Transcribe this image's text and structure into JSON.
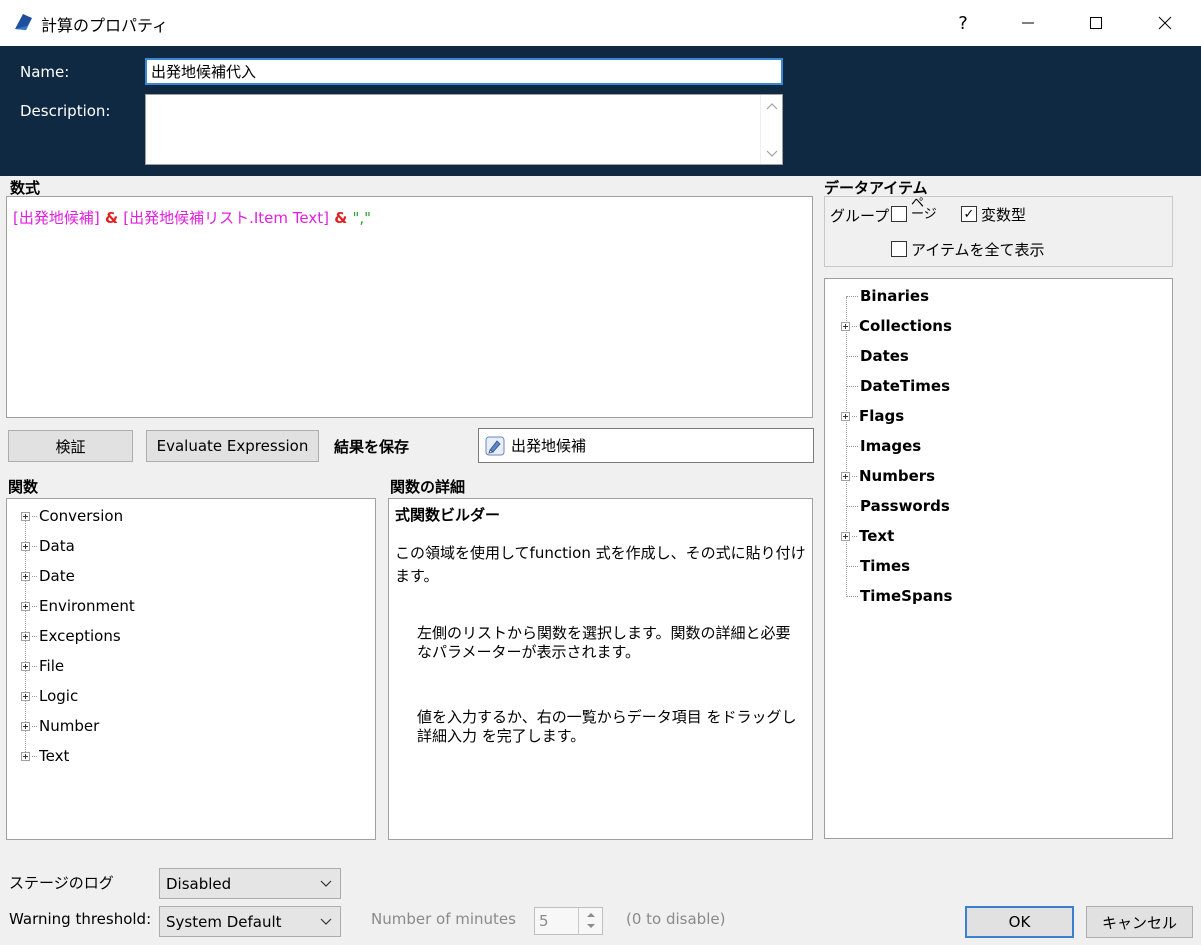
{
  "window": {
    "title": "計算のプロパティ",
    "help": "?",
    "app_icon": "blueprism-icon"
  },
  "header": {
    "name_label": "Name:",
    "name_value": "出発地候補代入",
    "description_label": "Description:",
    "description_value": ""
  },
  "formula": {
    "label": "数式",
    "tokens": [
      {
        "text": "[出発地候補]",
        "color": "#e020e0"
      },
      {
        "text": " & ",
        "color": "#e02020"
      },
      {
        "text": "[出発地候補リスト.Item Text]",
        "color": "#e020e0"
      },
      {
        "text": " & ",
        "color": "#e02020"
      },
      {
        "text": "\",\"",
        "color": "#30a030"
      }
    ]
  },
  "toolbar": {
    "verify_label": "検証",
    "evaluate_label": "Evaluate Expression",
    "save_result_label": "結果を保存",
    "save_result_value": "出発地候補"
  },
  "functions": {
    "label": "関数",
    "items": [
      "Conversion",
      "Data",
      "Date",
      "Environment",
      "Exceptions",
      "File",
      "Logic",
      "Number",
      "Text"
    ]
  },
  "details": {
    "label": "関数の詳細",
    "title": "式関数ビルダー",
    "intro": "この領域を使用してfunction 式を作成し、その式に貼り付けます。",
    "p1": "左側のリストから関数を選択します。関数の詳細と必要なパラメーターが表示されます。",
    "p2": "値を入力するか、右の一覧からデータ項目 をドラッグし詳細入力 を完了します。"
  },
  "data_items": {
    "label": "データアイテム",
    "group_label": "グループ",
    "page_label": "ページ",
    "page_checked": false,
    "vartype_label": "変数型",
    "vartype_checked": true,
    "show_all_label": "アイテムを全て表示",
    "show_all_checked": false,
    "tree": [
      {
        "label": "Binaries",
        "expandable": false
      },
      {
        "label": "Collections",
        "expandable": true
      },
      {
        "label": "Dates",
        "expandable": false
      },
      {
        "label": "DateTimes",
        "expandable": false
      },
      {
        "label": "Flags",
        "expandable": true
      },
      {
        "label": "Images",
        "expandable": false
      },
      {
        "label": "Numbers",
        "expandable": true
      },
      {
        "label": "Passwords",
        "expandable": false
      },
      {
        "label": "Text",
        "expandable": true
      },
      {
        "label": "Times",
        "expandable": false
      },
      {
        "label": "TimeSpans",
        "expandable": false
      }
    ]
  },
  "bottom": {
    "stage_log_label": "ステージのログ",
    "stage_log_value": "Disabled",
    "warning_label": "Warning threshold:",
    "warning_value": "System Default",
    "minutes_label": "Number of minutes",
    "minutes_value": "5",
    "disable_hint": "(0 to disable)",
    "ok_label": "OK",
    "cancel_label": "キャンセル"
  }
}
